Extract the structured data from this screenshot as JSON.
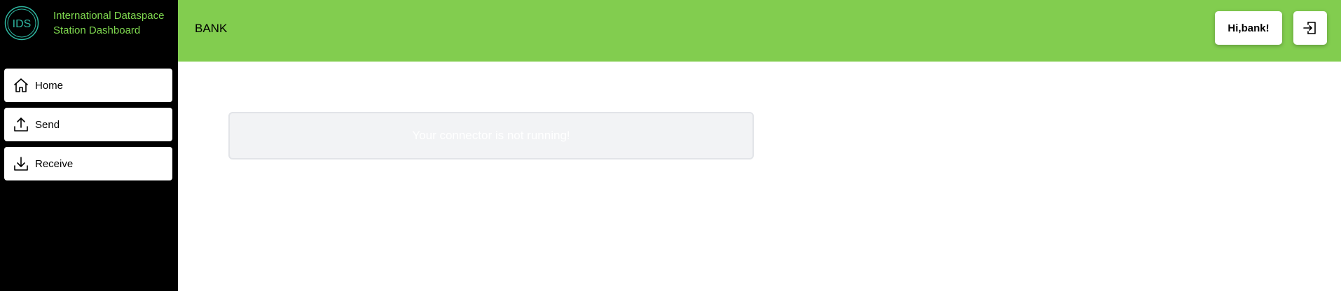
{
  "brand": {
    "logo_text": "IDS",
    "line1": "International Dataspace",
    "line2": "Station Dashboard"
  },
  "sidebar": {
    "items": [
      {
        "label": "Home",
        "icon": "home-icon"
      },
      {
        "label": "Send",
        "icon": "upload-icon"
      },
      {
        "label": "Receive",
        "icon": "download-icon"
      }
    ]
  },
  "header": {
    "title": "BANK",
    "greeting_prefix": "Hi,",
    "username": "bank",
    "greeting_suffix": "!",
    "logout_icon": "logout-icon"
  },
  "main": {
    "notice_text": "Your connector is not running!"
  },
  "colors": {
    "sidebar_bg": "#000000",
    "header_bg": "#82cd4f",
    "brand_text": "#7fd94f",
    "logo_ring": "#2fb8a2"
  }
}
